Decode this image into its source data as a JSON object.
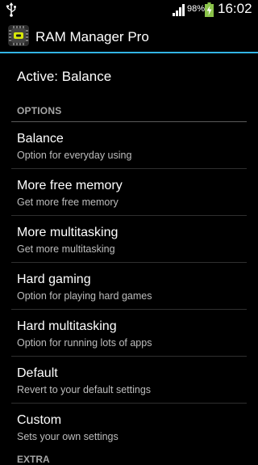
{
  "status_bar": {
    "battery_percent": "98%",
    "time": "16:02",
    "icons": [
      "usb-icon",
      "signal-icon",
      "battery-charging-icon"
    ]
  },
  "action_bar": {
    "app_icon": "ram-chip-icon",
    "title": "RAM Manager Pro",
    "divider_color": "#33b5e5"
  },
  "active_mode": "Active: Balance",
  "options": {
    "header": "OPTIONS",
    "items": [
      {
        "title": "Balance",
        "subtitle": "Option for everyday using"
      },
      {
        "title": "More free memory",
        "subtitle": "Get more free memory"
      },
      {
        "title": "More multitasking",
        "subtitle": "Get more multitasking"
      },
      {
        "title": "Hard gaming",
        "subtitle": "Option for playing hard games"
      },
      {
        "title": "Hard multitasking",
        "subtitle": "Option for running lots of apps"
      },
      {
        "title": "Default",
        "subtitle": "Revert to your default settings"
      },
      {
        "title": "Custom",
        "subtitle": "Sets your own settings"
      }
    ]
  },
  "next_section_header": "EXTRA"
}
